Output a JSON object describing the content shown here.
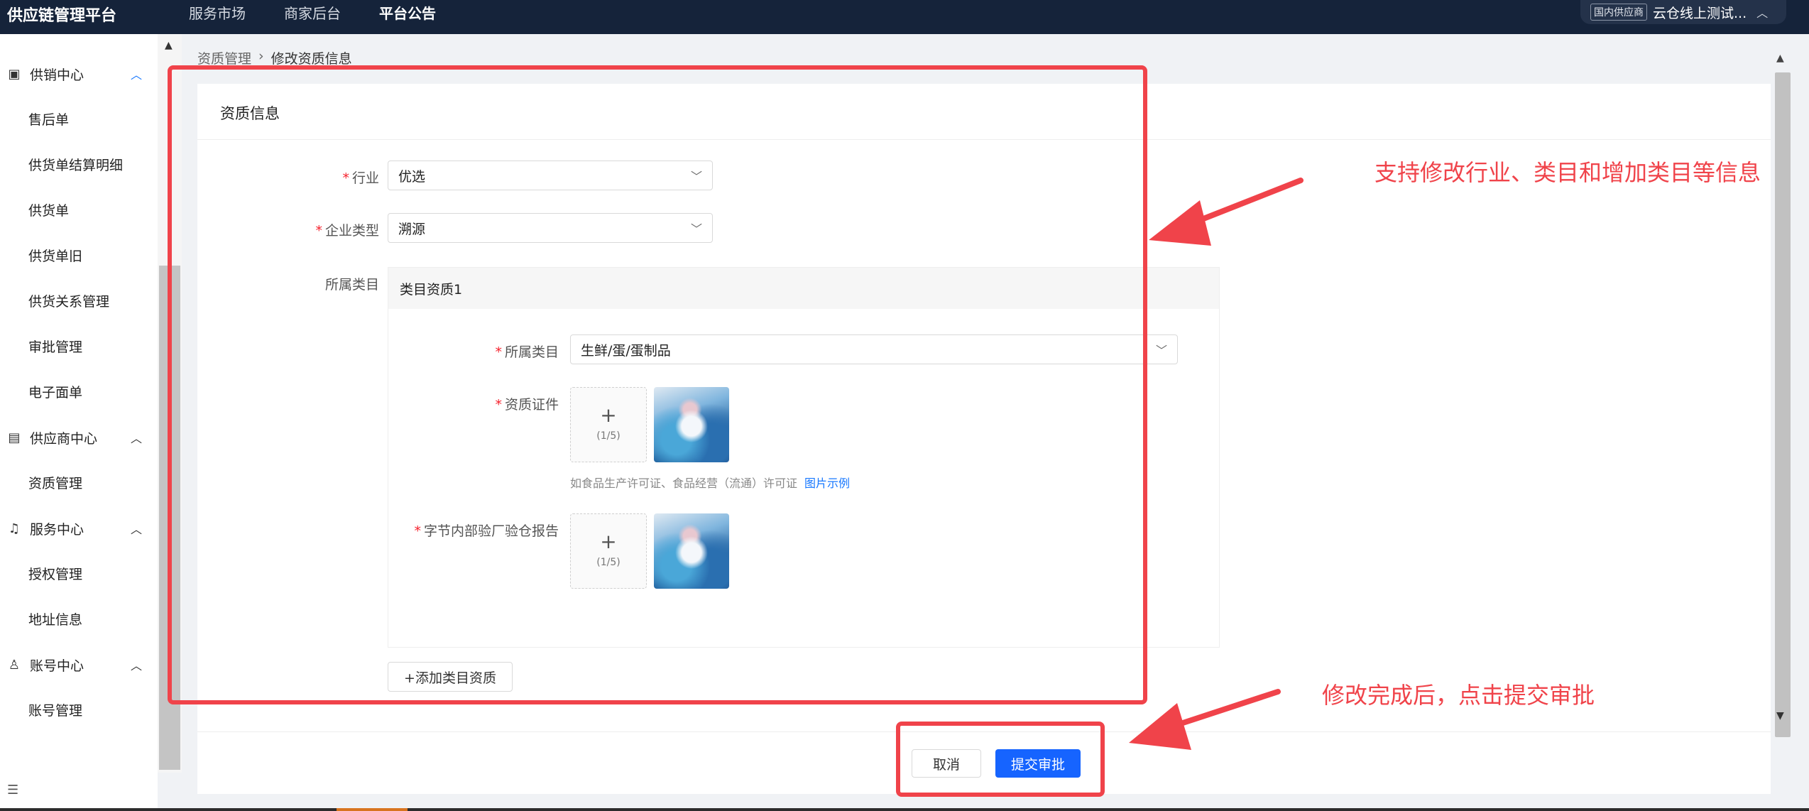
{
  "topbar": {
    "brand": "供应链管理平台",
    "nav": [
      "服务市场",
      "商家后台",
      "平台公告"
    ],
    "account_tag": "国内供应商",
    "account_name": "云仓线上测试..."
  },
  "sidebar": {
    "groups": [
      {
        "label": "供销中心",
        "icon": "list-icon",
        "items": [
          "售后单",
          "供货单结算明细",
          "供货单",
          "供货单旧",
          "供货关系管理",
          "审批管理",
          "电子面单"
        ]
      },
      {
        "label": "供应商中心",
        "icon": "document-icon",
        "items": [
          "资质管理"
        ]
      },
      {
        "label": "服务中心",
        "icon": "headset-icon",
        "items": [
          "授权管理",
          "地址信息"
        ]
      },
      {
        "label": "账号中心",
        "icon": "user-icon",
        "items": [
          "账号管理"
        ]
      }
    ]
  },
  "breadcrumb": {
    "parent": "资质管理",
    "current": "修改资质信息"
  },
  "form": {
    "card_title": "资质信息",
    "industry": {
      "label": "行业",
      "value": "优选"
    },
    "company_type": {
      "label": "企业类型",
      "value": "溯源"
    },
    "category_section_label": "所属类目",
    "category_block": {
      "title": "类目资质1",
      "category": {
        "label": "所属类目",
        "value": "生鲜/蛋/蛋制品"
      },
      "certificate": {
        "label": "资质证件",
        "count": "(1/5)",
        "hint": "如食品生产许可证、食品经营（流通）许可证",
        "hint_link": "图片示例"
      },
      "inspection_report": {
        "label": "字节内部验厂验仓报告",
        "count": "(1/5)"
      }
    },
    "add_button": "+添加类目资质"
  },
  "footer": {
    "cancel": "取消",
    "submit": "提交审批"
  },
  "annotations": {
    "top_note": "支持修改行业、类目和增加类目等信息",
    "bottom_note": "修改完成后，点击提交审批",
    "color": "#f0434a"
  }
}
